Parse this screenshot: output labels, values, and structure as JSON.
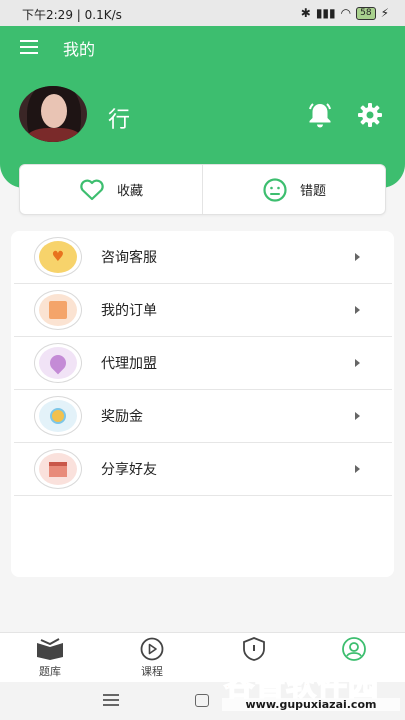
{
  "status": {
    "time": "下午2:29 | 0.1K/s",
    "battery": "58"
  },
  "header": {
    "title": "我的",
    "username": "行"
  },
  "quick": {
    "favorites": "收藏",
    "mistakes": "错题"
  },
  "menu": [
    {
      "label": "咨询客服",
      "icon": "heart-chat-icon",
      "color": "#f7d36b"
    },
    {
      "label": "我的订单",
      "icon": "order-envelope-icon",
      "color": "#f4a46a"
    },
    {
      "label": "代理加盟",
      "icon": "location-pin-icon",
      "color": "#c48bd6"
    },
    {
      "label": "奖励金",
      "icon": "coin-hand-icon",
      "color": "#7cc6e8"
    },
    {
      "label": "分享好友",
      "icon": "gift-box-icon",
      "color": "#e88b7a"
    }
  ],
  "tabs": [
    {
      "label": "题库",
      "icon": "book-icon"
    },
    {
      "label": "课程",
      "icon": "play-icon"
    },
    {
      "label": "",
      "icon": "shield-icon"
    },
    {
      "label": "",
      "icon": "user-icon"
    }
  ],
  "watermark": {
    "brand": "谷普软件园",
    "url": "www.gupuxiazai.com"
  },
  "colors": {
    "accent": "#3dbe6f"
  }
}
